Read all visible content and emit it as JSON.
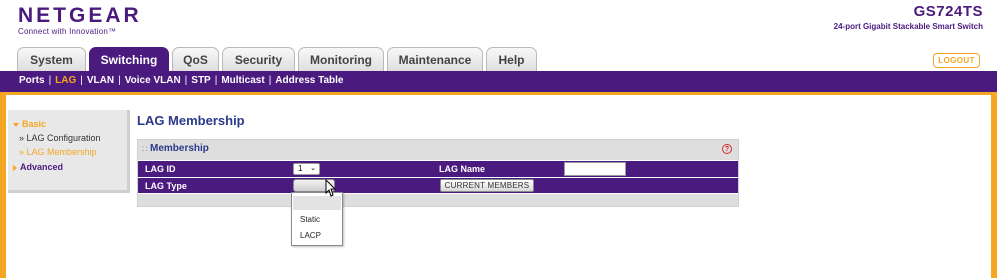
{
  "brand": {
    "logo": "NETGEAR",
    "tagline": "Connect with Innovation™"
  },
  "device": {
    "model": "GS724TS",
    "description": "24-port Gigabit Stackable Smart Switch"
  },
  "tabs": [
    {
      "label": "System"
    },
    {
      "label": "Switching"
    },
    {
      "label": "QoS"
    },
    {
      "label": "Security"
    },
    {
      "label": "Monitoring"
    },
    {
      "label": "Maintenance"
    },
    {
      "label": "Help"
    }
  ],
  "active_tab": "Switching",
  "logout_label": "LOGOUT",
  "subnav": [
    {
      "label": "Ports"
    },
    {
      "label": "LAG"
    },
    {
      "label": "VLAN"
    },
    {
      "label": "Voice VLAN"
    },
    {
      "label": "STP"
    },
    {
      "label": "Multicast"
    },
    {
      "label": "Address Table"
    }
  ],
  "active_subnav": "LAG",
  "leftmenu": {
    "basic": "Basic",
    "items": [
      {
        "label": "» LAG Configuration"
      },
      {
        "label": "» LAG Membership"
      }
    ],
    "advanced": "Advanced"
  },
  "page_title": "LAG Membership",
  "panel": {
    "title": "Membership",
    "help_icon": "?",
    "lag_id_label": "LAG ID",
    "lag_id_value": "1",
    "lag_name_label": "LAG Name",
    "lag_name_value": "",
    "lag_type_label": "LAG Type",
    "lag_type_value": "",
    "current_members_label": "CURRENT MEMBERS"
  },
  "lag_type_options": [
    "",
    "Static",
    "LACP"
  ],
  "colors": {
    "purple": "#4b1a7f",
    "orange": "#f5a623",
    "title_blue": "#2b3a8c"
  },
  "icons": {
    "caret": "chevron-down-icon",
    "cursor": "mouse-pointer-icon",
    "grip": "drag-handle-icon",
    "help": "help-icon"
  }
}
